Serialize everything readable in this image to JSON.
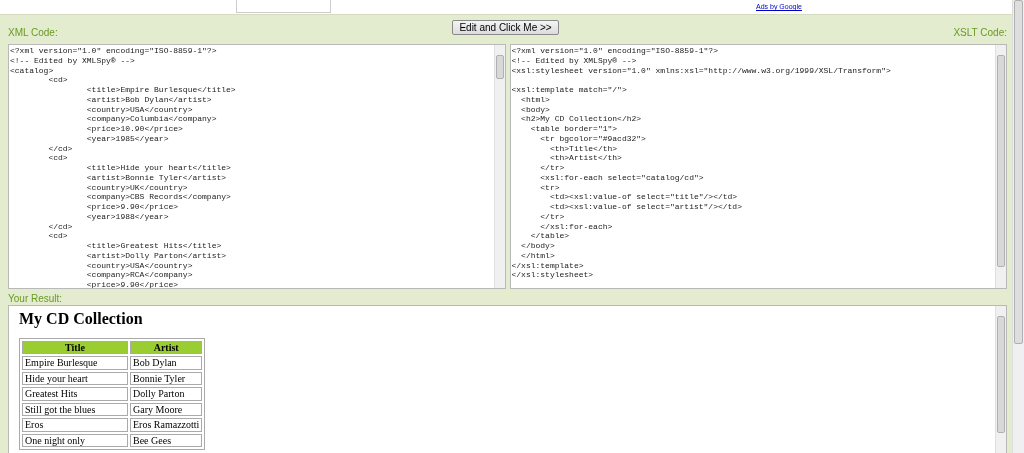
{
  "top_strip": {
    "ad_link": "Ads by Google"
  },
  "toolbar": {
    "xml_label": "XML Code:",
    "button": "Edit and Click Me >>",
    "xslt_label": "XSLT Code:"
  },
  "xml_code": "<?xml version=\"1.0\" encoding=\"ISO-8859-1\"?>\n<!-- Edited by XMLSpy® -->\n<catalog>\n\t<cd>\n\t\t<title>Empire Burlesque</title>\n\t\t<artist>Bob Dylan</artist>\n\t\t<country>USA</country>\n\t\t<company>Columbia</company>\n\t\t<price>10.90</price>\n\t\t<year>1985</year>\n\t</cd>\n\t<cd>\n\t\t<title>Hide your heart</title>\n\t\t<artist>Bonnie Tyler</artist>\n\t\t<country>UK</country>\n\t\t<company>CBS Records</company>\n\t\t<price>9.90</price>\n\t\t<year>1988</year>\n\t</cd>\n\t<cd>\n\t\t<title>Greatest Hits</title>\n\t\t<artist>Dolly Parton</artist>\n\t\t<country>USA</country>\n\t\t<company>RCA</company>\n\t\t<price>9.90</price>",
  "xslt_code": "<?xml version=\"1.0\" encoding=\"ISO-8859-1\"?>\n<!-- Edited by XMLSpy® -->\n<xsl:stylesheet version=\"1.0\" xmlns:xsl=\"http://www.w3.org/1999/XSL/Transform\">\n\n<xsl:template match=\"/\">\n  <html>\n  <body>\n  <h2>My CD Collection</h2>\n    <table border=\"1\">\n      <tr bgcolor=\"#9acd32\">\n        <th>Title</th>\n        <th>Artist</th>\n      </tr>\n      <xsl:for-each select=\"catalog/cd\">\n      <tr>\n        <td><xsl:value-of select=\"title\"/></td>\n        <td><xsl:value-of select=\"artist\"/></td>\n      </tr>\n      </xsl:for-each>\n    </table>\n  </body>\n  </html>\n</xsl:template>\n</xsl:stylesheet>",
  "result": {
    "label": "Your Result:",
    "heading": "My CD Collection",
    "table": {
      "columns": [
        "Title",
        "Artist"
      ],
      "rows": [
        [
          "Empire Burlesque",
          "Bob Dylan"
        ],
        [
          "Hide your heart",
          "Bonnie Tyler"
        ],
        [
          "Greatest Hits",
          "Dolly Parton"
        ],
        [
          "Still got the blues",
          "Gary Moore"
        ],
        [
          "Eros",
          "Eros Ramazzotti"
        ],
        [
          "One night only",
          "Bee Gees"
        ]
      ]
    }
  }
}
